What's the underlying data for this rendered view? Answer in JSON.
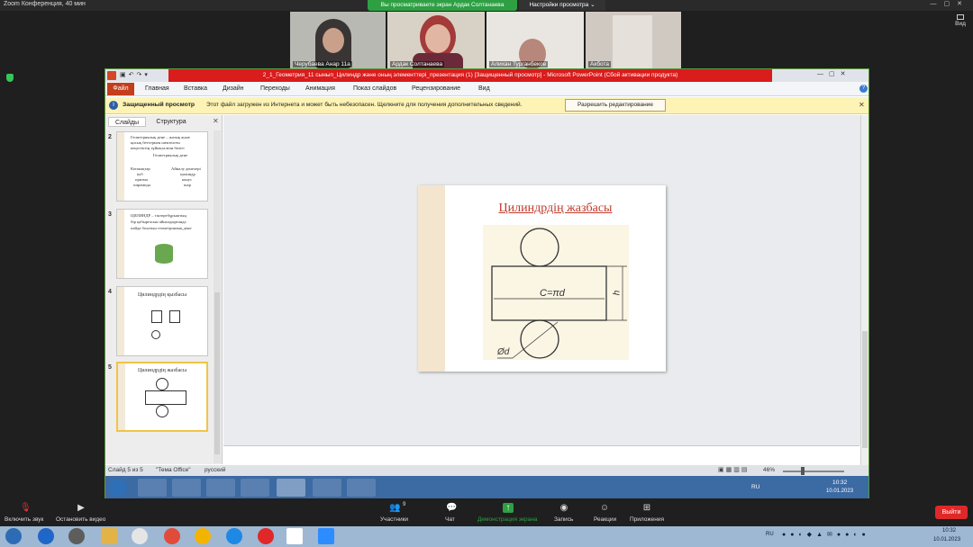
{
  "zoom": {
    "title": "Zoom Конференция, 40 мин",
    "share_banner": "Вы просматриваете экран Ардак Солтанаева",
    "view_options": "Настройки просмотра ⌄",
    "view_button": "Вид",
    "participants": [
      {
        "name": "Черубаева Анар 11а"
      },
      {
        "name": "Ардак Солтанаева"
      },
      {
        "name": "Алихан Турганбеков"
      },
      {
        "name": "Акбота"
      }
    ],
    "toolbar": {
      "mute": "Включить звук",
      "video": "Остановить видео",
      "participants": "Участники",
      "participants_count": "9",
      "chat": "Чат",
      "share": "Демонстрация экрана",
      "record": "Запись",
      "reactions": "Реакции",
      "apps": "Приложения",
      "leave": "Выйти"
    },
    "clock": {
      "time": "10:32",
      "date": "10.01.2023"
    },
    "lang": "RU"
  },
  "ppt": {
    "title": "2_1_Геометрия_11 сынып_Цилиндр және оның элементтері_презентация (1) [Защищенный просмотр] - Microsoft PowerPoint (Сбой активации продукта)",
    "tabs": [
      "Главная",
      "Вставка",
      "Дизайн",
      "Переходы",
      "Анимация",
      "Показ слайдов",
      "Рецензирование",
      "Вид"
    ],
    "file_tab": "Файл",
    "protected_label": "Защищенный просмотр",
    "protected_msg": "Этот файл загружен из Интернета и может быть небезопасен. Щелкните для получения дополнительных сведений.",
    "enable_edit": "Разрешить редактирование",
    "pane_tabs": {
      "slides": "Слайды",
      "outline": "Структура"
    },
    "thumbs": [
      {
        "num": "2",
        "lines": [
          "Геометриялық дене – жазық және",
          "қисық беттермен шектелген",
          "кеңістіктің тұйықталған бөлігі",
          "Геометриялық дене",
          "Көпжақтар",
          "куб",
          "призма",
          "пирамида",
          "Айналу денелері",
          "цилиндр",
          "конус",
          "шар"
        ]
      },
      {
        "num": "3",
        "lines": [
          "ЦИЛИНДР – тіктөртбұрыштың",
          "бір қабырғасын айналдырғанда",
          "пайда болатын геометриялық дене"
        ]
      },
      {
        "num": "4",
        "title": "Цилиндрдің қызбасы"
      },
      {
        "num": "5",
        "title": "Цилиндрдің жазбасы"
      }
    ],
    "slide": {
      "title": "Цилиндрдің жазбасы",
      "circumference": "C=πd",
      "height": "h",
      "diameter": "Ød"
    },
    "status": {
      "slide": "Слайд 5 из 5",
      "theme": "\"Тема Office\"",
      "lang": "русский",
      "zoom": "46%"
    },
    "tray": {
      "lang": "RU",
      "time": "10:32",
      "date": "10.01.2023"
    }
  },
  "colors": {
    "ppt_title_bar": "#d91c1c",
    "share_green": "#2ea043",
    "leave_red": "#e02828"
  }
}
